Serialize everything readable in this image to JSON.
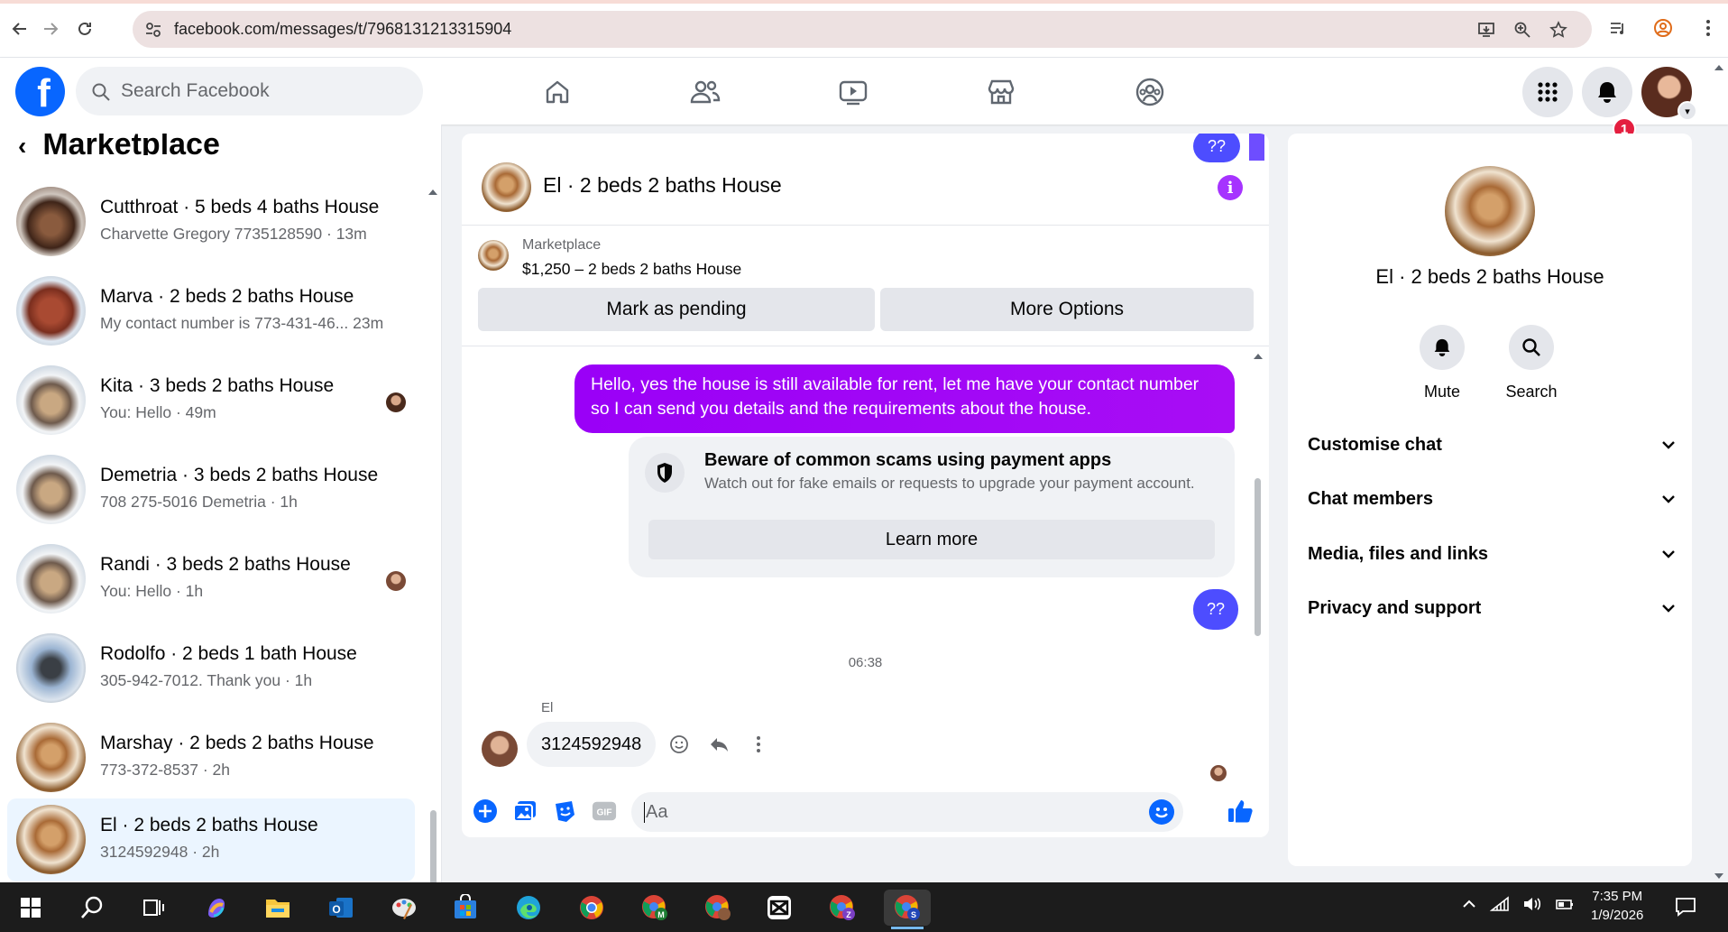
{
  "browser": {
    "url": "facebook.com/messages/t/7968131213315904"
  },
  "header": {
    "search_placeholder": "Search Facebook",
    "notification_count": "1",
    "tabs": [
      "home-icon",
      "friends-icon",
      "watch-icon",
      "marketplace-icon",
      "groups-icon"
    ]
  },
  "sidebar": {
    "title": "Marketplace",
    "conversations": [
      {
        "name": "Cutthroat · 5 beds 4 baths House",
        "preview": "Charvette Gregory 7735128590 · 13m"
      },
      {
        "name": "Marva · 2 beds 2 baths House",
        "preview": "My contact number is 773-431-46... 23m"
      },
      {
        "name": "Kita · 3 beds 2 baths House",
        "preview": "You: Hello · 49m"
      },
      {
        "name": "Demetria · 3 beds 2 baths House",
        "preview": "708 275-5016 Demetria · 1h"
      },
      {
        "name": "Randi · 3 beds 2 baths House",
        "preview": "You: Hello · 1h"
      },
      {
        "name": "Rodolfo · 2 beds 1 bath House",
        "preview": "305-942-7012. Thank you · 1h"
      },
      {
        "name": "Marshay · 2 beds 2 baths House",
        "preview": "773-372-8537 · 2h"
      },
      {
        "name": "El · 2 beds 2 baths House",
        "preview": "3124592948 · 2h"
      }
    ]
  },
  "conversation": {
    "title": "El · 2 beds 2 baths House",
    "top_bubble": "??",
    "marketplace_label": "Marketplace",
    "listing": "$1,250 – 2 beds 2 baths House",
    "mark_pending": "Mark as pending",
    "more_options": "More Options",
    "outgoing_message": "Hello, yes the house is still available for rent, let me have your contact number so I can send you details and the requirements about the house.",
    "scam_title": "Beware of common scams using payment apps",
    "scam_text": "Watch out for fake emails or requests to upgrade your payment account.",
    "learn_more": "Learn more",
    "second_bubble": "??",
    "timestamp": "06:38",
    "sender_name": "El",
    "incoming_message": "3124592948",
    "composer_placeholder": "Aa"
  },
  "details": {
    "title": "El · 2 beds 2 baths House",
    "mute_label": "Mute",
    "search_label": "Search",
    "sections": [
      "Customise chat",
      "Chat members",
      "Media, files and links",
      "Privacy and support"
    ]
  },
  "taskbar": {
    "time": "7:35 PM",
    "date": "1/9/2026"
  },
  "colors": {
    "fb_blue": "#0866ff",
    "outgoing_bubble": "#a100ff",
    "question_bubble": "#4d4dff"
  }
}
